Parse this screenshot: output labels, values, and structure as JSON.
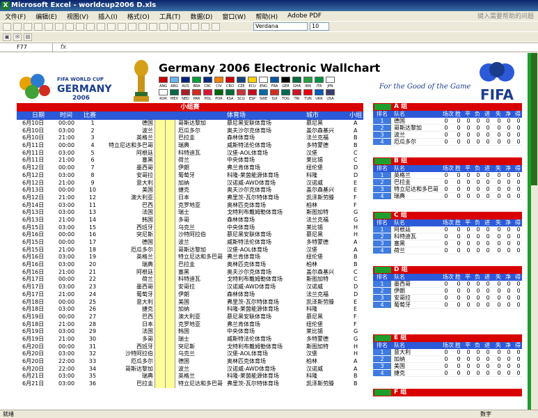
{
  "window": {
    "title": "Microsoft Excel - worldcup2006 D.xls",
    "help_placeholder": "键入需要帮助的问题"
  },
  "menu": [
    "文件(F)",
    "编辑(E)",
    "视图(V)",
    "插入(I)",
    "格式(O)",
    "工具(T)",
    "数据(D)",
    "窗口(W)",
    "帮助(H)",
    "Adobe PDF"
  ],
  "toolbar": {
    "font": "Verdana",
    "size": "10"
  },
  "formula": {
    "cell": "F77",
    "fx": "fx"
  },
  "header": {
    "title": "Germany 2006 Electronic Wallchart",
    "wc_label": "FIFA WORLD CUP",
    "wc_country": "GERMANY",
    "wc_year": "2006",
    "slogan": "For the Good of the Game",
    "fifa": "FIFA",
    "codes_row1": [
      "ANG",
      "ARG",
      "AUS",
      "BRA",
      "CRC",
      "CIV",
      "CRO",
      "CZE",
      "ECU",
      "ENG",
      "FRA",
      "GER",
      "GHA",
      "IRN",
      "ITA",
      "JPN"
    ],
    "codes_row2": [
      "KOR",
      "MEX",
      "NED",
      "PAR",
      "POL",
      "POR",
      "KSA",
      "SCG",
      "ESP",
      "SWE",
      "SUI",
      "TOG",
      "TRI",
      "TUN",
      "UKR",
      "USA"
    ],
    "flag_colors_row1": [
      "#c00",
      "#6cb4ee",
      "#00247d",
      "#009b3a",
      "#002b7f",
      "#f77f00",
      "#c00",
      "#11457e",
      "#ffd100",
      "#fff",
      "#0055a4",
      "#000",
      "#006b3f",
      "#239f40",
      "#009246",
      "#fff"
    ],
    "flag_colors_row2": [
      "#fff",
      "#006847",
      "#ae1c28",
      "#d52b1e",
      "#dc143c",
      "#006600",
      "#006c35",
      "#c6363c",
      "#c60b1e",
      "#006aa7",
      "#d52b1e",
      "#006a4e",
      "#ce1126",
      "#e70013",
      "#005bbb",
      "#3c3b6e"
    ]
  },
  "schedule": {
    "title": "小组赛",
    "cols": {
      "date": "日期",
      "time": "时间",
      "match": "比赛",
      "venue": "体育场",
      "city": "城市",
      "group": "小组"
    },
    "rows": [
      [
        "6月10日",
        "00:00",
        "1",
        "德国",
        "哥斯达黎加",
        "慕尼黑安联体育场",
        "慕尼黑",
        "A"
      ],
      [
        "6月10日",
        "03:00",
        "2",
        "波兰",
        "厄瓜多尔",
        "奥夫沙尔克体育场",
        "盖尔森基兴",
        "A"
      ],
      [
        "6月10日",
        "21:00",
        "3",
        "英格兰",
        "巴拉圭",
        "森林体育场",
        "法兰克福",
        "B"
      ],
      [
        "6月11日",
        "00:00",
        "4",
        "特立尼达和多巴哥",
        "瑞典",
        "威斯特法伦体育场",
        "多特蒙德",
        "B"
      ],
      [
        "6月11日",
        "03:00",
        "5",
        "阿根廷",
        "科特迪瓦",
        "汉堡-AOL体育场",
        "汉堡",
        "C"
      ],
      [
        "6月11日",
        "21:00",
        "6",
        "塞黑",
        "荷兰",
        "中央体育场",
        "莱比锡",
        "C"
      ],
      [
        "6月12日",
        "00:00",
        "7",
        "墨西哥",
        "伊朗",
        "弗兰肯体育场",
        "纽伦堡",
        "D"
      ],
      [
        "6月12日",
        "03:00",
        "8",
        "安哥拉",
        "葡萄牙",
        "科隆-莱茵能源体育场",
        "科隆",
        "D"
      ],
      [
        "6月12日",
        "21:00",
        "9",
        "意大利",
        "加纳",
        "汉诺威-AWD体育场",
        "汉诺威",
        "E"
      ],
      [
        "6月13日",
        "00:00",
        "10",
        "美国",
        "捷克",
        "奥夫沙尔克体育场",
        "盖尔森基兴",
        "E"
      ],
      [
        "6月12日",
        "21:00",
        "12",
        "澳大利亚",
        "日本",
        "弗里茨-瓦尔特体育场",
        "凯泽斯劳滕",
        "F"
      ],
      [
        "6月14日",
        "03:00",
        "11",
        "巴西",
        "克罗地亚",
        "奥林匹克体育场",
        "柏林",
        "F"
      ],
      [
        "6月13日",
        "03:00",
        "13",
        "法国",
        "瑞士",
        "戈特利布戴姆勒体育场",
        "斯图加特",
        "G"
      ],
      [
        "6月13日",
        "21:00",
        "14",
        "韩国",
        "多哥",
        "森林体育场",
        "法兰克福",
        "G"
      ],
      [
        "6月15日",
        "03:00",
        "15",
        "西班牙",
        "乌克兰",
        "中央体育场",
        "莱比锡",
        "H"
      ],
      [
        "6月16日",
        "00:00",
        "16",
        "突尼斯",
        "沙特阿拉伯",
        "慕尼黑安联体育场",
        "慕尼黑",
        "H"
      ],
      [
        "6月15日",
        "00:00",
        "17",
        "德国",
        "波兰",
        "威斯特法伦体育场",
        "多特蒙德",
        "A"
      ],
      [
        "6月15日",
        "21:00",
        "18",
        "厄瓜多尔",
        "哥斯达黎加",
        "汉堡-AOL体育场",
        "汉堡",
        "A"
      ],
      [
        "6月16日",
        "03:00",
        "19",
        "英格兰",
        "特立尼达和多巴哥",
        "弗兰肯体育场",
        "纽伦堡",
        "B"
      ],
      [
        "6月16日",
        "03:00",
        "20",
        "瑞典",
        "巴拉圭",
        "奥林匹克体育场",
        "柏林",
        "B"
      ],
      [
        "6月16日",
        "21:00",
        "21",
        "阿根廷",
        "塞黑",
        "奥夫沙尔克体育场",
        "盖尔森基兴",
        "C"
      ],
      [
        "6月17日",
        "00:00",
        "22",
        "荷兰",
        "科特迪瓦",
        "戈特利布戴姆勒体育场",
        "斯图加特",
        "C"
      ],
      [
        "6月17日",
        "03:00",
        "23",
        "墨西哥",
        "安哥拉",
        "汉诺威-AWD体育场",
        "汉诺威",
        "D"
      ],
      [
        "6月17日",
        "21:00",
        "24",
        "葡萄牙",
        "伊朗",
        "森林体育场",
        "法兰克福",
        "D"
      ],
      [
        "6月18日",
        "00:00",
        "25",
        "意大利",
        "美国",
        "弗里茨-瓦尔特体育场",
        "凯泽斯劳滕",
        "E"
      ],
      [
        "6月18日",
        "03:00",
        "26",
        "捷克",
        "加纳",
        "科隆-莱茵能源体育场",
        "科隆",
        "E"
      ],
      [
        "6月19日",
        "00:00",
        "27",
        "巴西",
        "澳大利亚",
        "慕尼黑安联体育场",
        "慕尼黑",
        "F"
      ],
      [
        "6月18日",
        "21:00",
        "28",
        "日本",
        "克罗地亚",
        "弗兰肯体育场",
        "纽伦堡",
        "F"
      ],
      [
        "6月19日",
        "03:00",
        "29",
        "法国",
        "韩国",
        "中央体育场",
        "莱比锡",
        "G"
      ],
      [
        "6月19日",
        "21:00",
        "30",
        "多哥",
        "瑞士",
        "威斯特法伦体育场",
        "多特蒙德",
        "G"
      ],
      [
        "6月20日",
        "00:00",
        "31",
        "西班牙",
        "突尼斯",
        "戈特利布戴姆勒体育场",
        "斯图加特",
        "H"
      ],
      [
        "6月20日",
        "03:00",
        "32",
        "沙特阿拉伯",
        "乌克兰",
        "汉堡-AOL体育场",
        "汉堡",
        "H"
      ],
      [
        "6月20日",
        "22:00",
        "33",
        "厄瓜多尔",
        "德国",
        "奥林匹克体育场",
        "柏林",
        "A"
      ],
      [
        "6月20日",
        "22:00",
        "34",
        "哥斯达黎加",
        "波兰",
        "汉诺威-AWD体育场",
        "汉诺威",
        "A"
      ],
      [
        "6月21日",
        "03:00",
        "35",
        "瑞典",
        "英格兰",
        "科隆-莱茵能源体育场",
        "科隆",
        "B"
      ],
      [
        "6月21日",
        "03:00",
        "36",
        "巴拉圭",
        "特立尼达和多巴哥",
        "弗里茨-瓦尔特体育场",
        "凯泽斯劳滕",
        "B"
      ]
    ]
  },
  "group_head": {
    "rank": "排名",
    "team": "队名",
    "stats": [
      "场次",
      "胜",
      "平",
      "负",
      "进",
      "失",
      "净",
      "得分"
    ]
  },
  "groups": [
    {
      "title": "A 组",
      "teams": [
        "德国",
        "哥斯达黎加",
        "波兰",
        "厄瓜多尔"
      ]
    },
    {
      "title": "B 组",
      "teams": [
        "英格兰",
        "巴拉圭",
        "特立尼达和多巴哥",
        "瑞典"
      ]
    },
    {
      "title": "C 组",
      "teams": [
        "阿根廷",
        "科特迪瓦",
        "塞黑",
        "荷兰"
      ]
    },
    {
      "title": "D 组",
      "teams": [
        "墨西哥",
        "伊朗",
        "安哥拉",
        "葡萄牙"
      ]
    },
    {
      "title": "E 组",
      "teams": [
        "意大利",
        "加纳",
        "美国",
        "捷克"
      ]
    },
    {
      "title": "F 组",
      "teams": []
    }
  ],
  "zero": "0",
  "status": {
    "left": "就绪",
    "right": "数字"
  }
}
